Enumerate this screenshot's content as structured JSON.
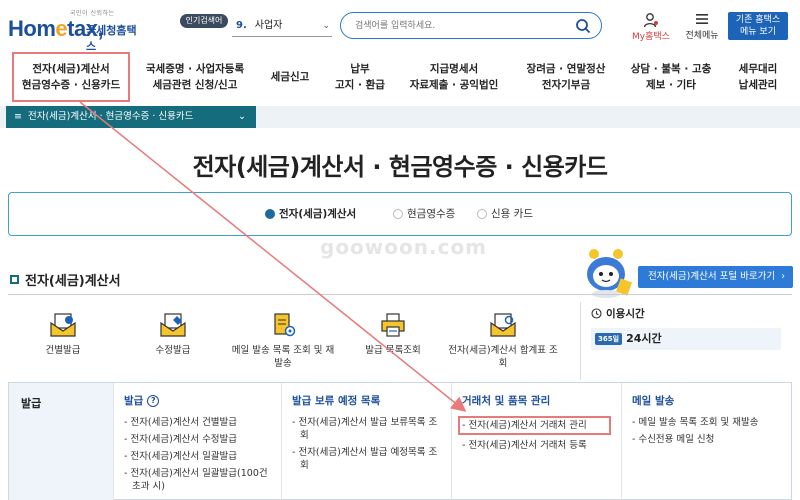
{
  "header": {
    "logo_small": "국민이 신뢰하는",
    "logo_main": "Hometax",
    "logo_kr": "국세청홈택스",
    "popular_badge": "인기검색어",
    "popular_num": "9.",
    "popular_value": "사업자",
    "search_placeholder": "검색어를 입력하세요.",
    "my_hometax": "My홈택스",
    "all_menu": "전체메뉴",
    "old_menu_line1": "기존 홈택스",
    "old_menu_line2": "메뉴 보기"
  },
  "nav": [
    {
      "line1": "전자(세금)계산서",
      "line2": "현금영수증 · 신용카드"
    },
    {
      "line1": "국세증명 · 사업자등록",
      "line2": "세금관련 신청/신고"
    },
    {
      "line1": "세금신고",
      "line2": ""
    },
    {
      "line1": "납부",
      "line2": "고지 · 환급"
    },
    {
      "line1": "지급명세서",
      "line2": "자료제출 · 공익법인"
    },
    {
      "line1": "장려금 · 연말정산",
      "line2": "전자기부금"
    },
    {
      "line1": "상담 · 불복 · 고충",
      "line2": "제보 · 기타"
    },
    {
      "line1": "세무대리",
      "line2": "납세관리"
    }
  ],
  "breadcrumb": "전자(세금)계산서 · 현금영수증 · 신용카드",
  "page_title": "전자(세금)계산서 · 현금영수증 · 신용카드",
  "tabs": [
    "전자(세금)계산서",
    "현금영수증",
    "신용 카드"
  ],
  "watermark": "goowoon.com",
  "section_title": "전자(세금)계산서",
  "portal_button": "전자(세금)계산서 포털 바로가기",
  "quick_menu": [
    {
      "label": "건별발급"
    },
    {
      "label": "수정발급"
    },
    {
      "label": "메일 발송 목록 조회 및 재발송"
    },
    {
      "label": "발급 목록조회"
    },
    {
      "label": "전자(세금)계산서 합계표 조회"
    }
  ],
  "usage": {
    "title": "이용시간",
    "badge": "365일",
    "value": "24시간"
  },
  "bottom": {
    "left_label": "발급",
    "columns": [
      {
        "title": "발급",
        "help": "?",
        "items": [
          "전자(세금)계산서 건별발급",
          "전자(세금)계산서 수정발급",
          "전자(세금)계산서 일괄발급",
          "전자(세금)계산서 일괄발급(100건 초과 시)"
        ]
      },
      {
        "title": "발급 보류 예정 목록",
        "items": [
          "전자(세금)계산서 발급 보류목록 조회",
          "전자(세금)계산서 발급 예정목록 조회"
        ]
      },
      {
        "title": "거래처 및 품목 관리",
        "items": [
          "전자(세금)계산서 거래처 관리",
          "전자(세금)계산서 거래처 등록"
        ]
      },
      {
        "title": "메일 발송",
        "items": [
          "메일 발송 목록 조회 및 재발송",
          "수신전용 메일 신청"
        ]
      }
    ]
  },
  "colors": {
    "brand": "#1d4f9c",
    "teal": "#156c7c",
    "highlight": "#e87a7a",
    "accent": "#2d7bd6"
  }
}
